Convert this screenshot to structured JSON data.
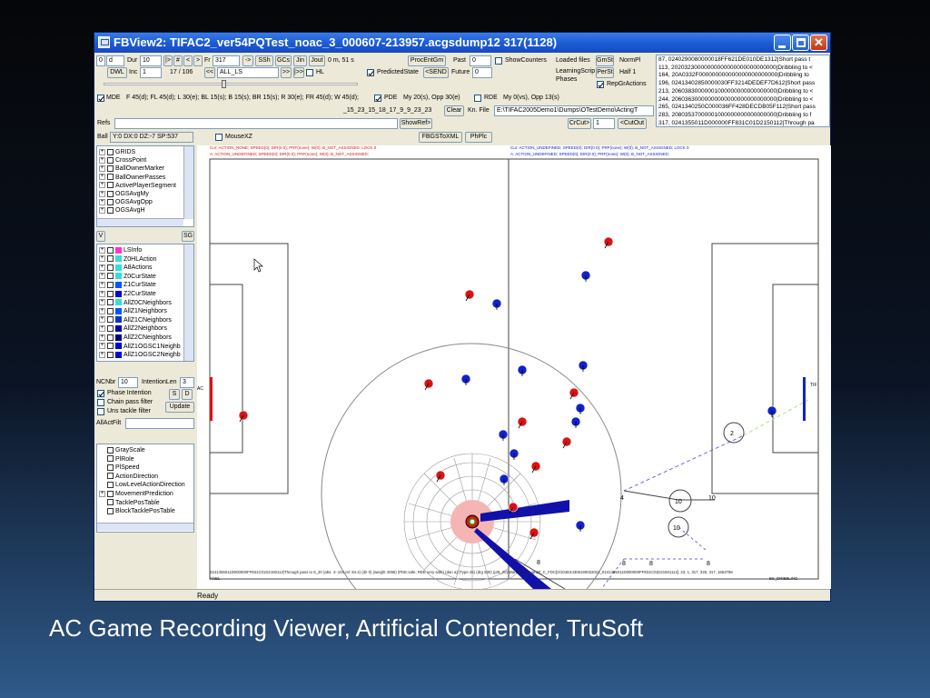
{
  "window": {
    "title": "FBView2: TIFAC2_ver54PQTest_noac_3_000607-213957.acgsdump12  317(1128)"
  },
  "toolbar": {
    "row1": {
      "frame_combo": "0",
      "d_combo": "d",
      "dur_label": "Dur",
      "dur_value": "10",
      "nav_buttons": [
        "|>",
        "#",
        "<",
        ">"
      ],
      "fr_label": "Fr",
      "fr_value": "317",
      "go_button": "->",
      "ssh": "SSh",
      "gcs": "GCs",
      "jin": "Jin",
      "jout": "Jout",
      "time_text": "0 m, 51 s",
      "procentgm": "ProcEntGm",
      "past_label": "Past",
      "past_value": "0",
      "showcounters": "ShowCounters",
      "loaded_files": "Loaded files",
      "gmst": "GmSt",
      "normpl": "NormPl"
    },
    "row2": {
      "dwl": "DWL",
      "inc_label": "Inc",
      "inc_value": "1",
      "progress": "17 / 106",
      "back": "<<",
      "all_ls": "ALL_LS",
      "fwd": ">>",
      "fwd2": "|>>",
      "hl": "HL",
      "predictedstate": "PredictedState",
      "send": "<SEND",
      "future_label": "Future",
      "future_value": "0",
      "learning": "LearningScrip Phases",
      "perst": "PerSt",
      "half": "Half 1",
      "repgractions": "RepGrActions"
    },
    "row3": {
      "mde": "MDE",
      "mde_text": "F 45(d); FL 45(d); L 30(e); BL 15(s); B 15(s); BR 15(s); R 30(e); FR 45(d); W 45(d);",
      "pde": "PDE",
      "pde_text": "My 20(s), Opp 30(e)",
      "rde": "RDE",
      "rde_text": "My 0(vs), Opp 13(s)"
    },
    "row4": {
      "seq_text": "_15_23_15_18_17_9_9_23_23",
      "clear": "Clear",
      "kn_file": "Kn. File",
      "path": "E:\\TIFAC2005Demo1\\Dumps\\OTestDemo\\ActingT"
    },
    "row5": {
      "refs_label": "Refs",
      "showref": "ShowRef>",
      "crcut": "CrCut>",
      "crcut_value": "1",
      "cutout": "<CutOut"
    },
    "row6": {
      "ball_label": "Ball",
      "ball_text": "Y:0 DX:0 DZ:-7 SP:537",
      "mousexz": "MouseXZ",
      "fbgstoxml": "FBGSToXML",
      "phplc": "PhPlc"
    }
  },
  "action_list": [
    "87, 0240290080000018FF621DE010DE1312|Short pass t",
    "113, 20203230000000000000000000000000|Dribbling to <",
    "164, 20A0332F000000000000000000000000|Dribbling to",
    "196, 02413402850000030FF3214DEDEF7D612|Short pass",
    "213, 20603830000001000000000000000000|Dribbling to <",
    "244, 20603630000000000000000000000000|Dribbling to <",
    "265, 0241340250C000036FF428DECDB05F112|Short pass",
    "283, 20803537000001000000000000000000|Dribbling to f",
    "317, 0241355011D000000FF831C01D2150112|Through pa"
  ],
  "tree1": [
    "GRIDS",
    "CrossPoint",
    "BallOwnerMarker",
    "BallOwnerPasses",
    "ActivePlayerSegment",
    "OGSAvgMy",
    "OGSAvgOpp",
    "OGSAvgH"
  ],
  "tree2_header": {
    "v": "V",
    "sg": "SG"
  },
  "tree2": [
    {
      "label": "LSInfo",
      "color": "#ff33cc"
    },
    {
      "label": "Z0HLAction",
      "color": "#33dddd"
    },
    {
      "label": "A8Actions",
      "color": "#33dddd"
    },
    {
      "label": "Z0CurState",
      "color": "#33dddd"
    },
    {
      "label": "Z1CurState",
      "color": "#0055ff"
    },
    {
      "label": "Z2CurState",
      "color": "#0000cc"
    },
    {
      "label": "AllZ0CNeighbors",
      "color": "#33dddd"
    },
    {
      "label": "AllZ1Neighbors",
      "color": "#0055ff"
    },
    {
      "label": "AllZ1CNeighbors",
      "color": "#0033cc"
    },
    {
      "label": "AllZ2Neighbors",
      "color": "#0000aa"
    },
    {
      "label": "AllZ2CNeighbors",
      "color": "#000088"
    },
    {
      "label": "AllZ1OGSC1Neighb",
      "color": "#0000cc"
    },
    {
      "label": "AllZ1OGSC2Neighb",
      "color": "#0000cc"
    }
  ],
  "filters": {
    "ncnbr_label": "NCNbr",
    "ncnbr_value": "10",
    "intentlen_label": "IntentionLen",
    "intentlen_value": "3",
    "phase_intention": "Phase Intention",
    "chain_pass": "Chain pass filter",
    "uns_tackle": "Uns tackle filter",
    "s": "S",
    "d": "D",
    "update": "Update",
    "allactfilt": "AllActFilt"
  },
  "tree3": [
    "GrayScale",
    "PlRole",
    "PlSpeed",
    "ActionDirection",
    "LowLevelActionDirection",
    "MovementPrediction",
    "TacklePosTable",
    "BlockTacklePosTable"
  ],
  "field": {
    "left_info1": "Cur: ACTION_NONE; SPEED(0); DIR(0.0); PRF(none); W(0); B_NOT_ASSIGNED;  LOCK 0",
    "left_info2": "A: ACTION_UNDEFINED; SPEED(0); DIR(0.0); PRF(none); W(0); B_NOT_ASSIGNED;",
    "right_info1": "Cur: ACTION_UNDEFINED; SPEED(0); DIR(0.0); PRF(none); W(0); B_NOT_ASSIGNED;  LOCK 0",
    "right_info2": "A: ACTION_UNDEFINED; SPEED(0); DIR(0.0); PRF(none); W(0); B_NOT_ASSIGNED;",
    "left_goal_label": "AC",
    "right_goal_label": "TIF",
    "bottom_text": "0241355011D000000FF831C01D2150112|Through pass to 8_20 (abs: 4:-104 rel: 84.4) (dir 0) (weight 4096) (PDE:safe; RDE very safe) (dan a) (Type 25) (drg 530) (p/8_20) WantToThrough20_C_FDC[0/104D44306190022021_0241355011D000000FF831C01D21501112], 23, 1, 317, 326, 317, 1863786",
    "bottom_left": "ANEL",
    "bottom_right": "BS_DRIBBLING",
    "numbers_8": "8",
    "numbers_10": "10",
    "numbers_4": "4",
    "numbers_2": "2"
  },
  "status": "Ready",
  "caption": "AC Game Recording Viewer, Artificial Contender, TruSoft",
  "colors": {
    "red_team": "#dd1111",
    "blue_team": "#1122cc",
    "title_blue": "#1f5fd8"
  }
}
